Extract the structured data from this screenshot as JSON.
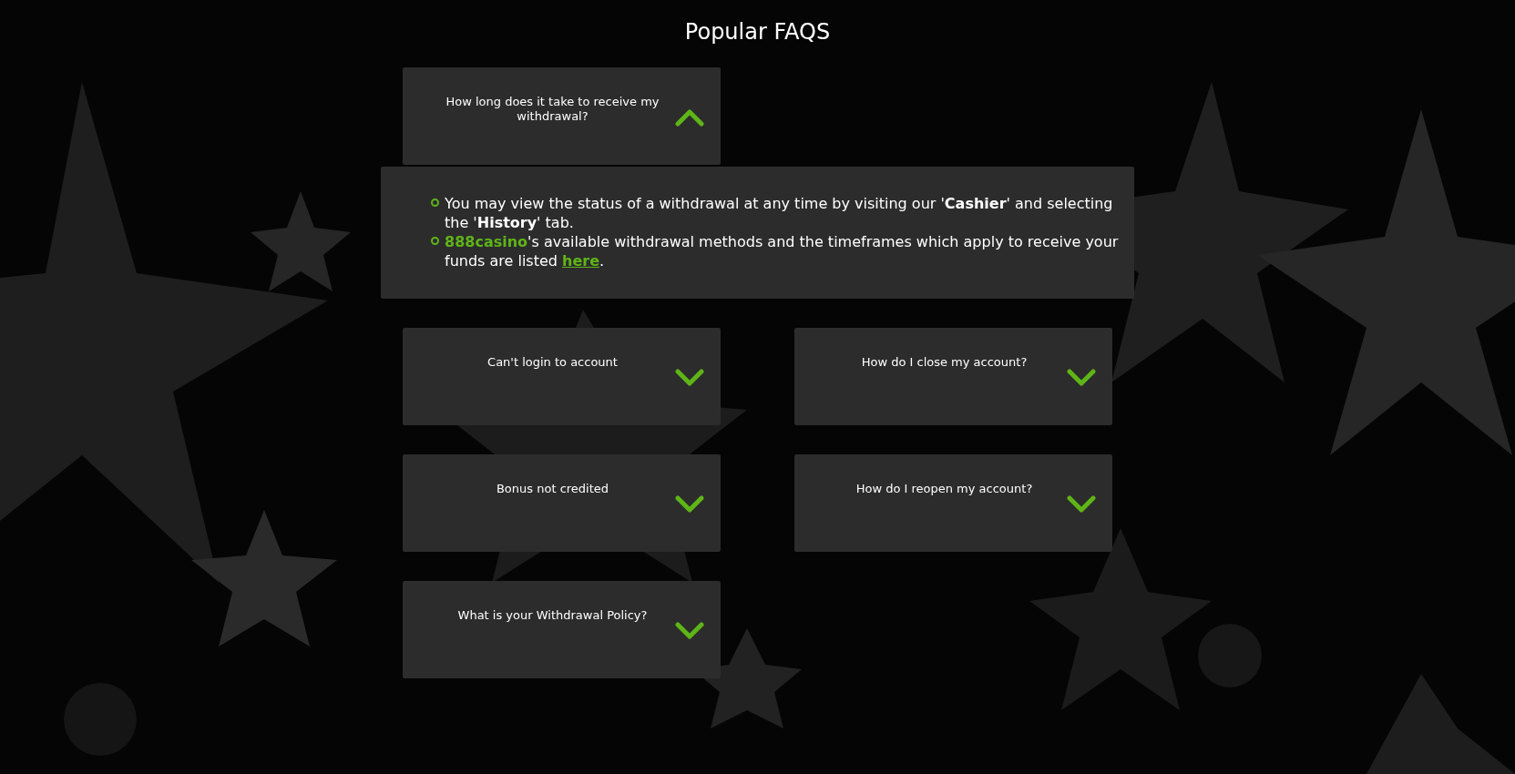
{
  "title": "Popular FAQS",
  "faqs": [
    {
      "question": "How long does it take to receive my withdrawal?",
      "expanded": true,
      "answer": [
        [
          {
            "kind": "plain",
            "text": "You may view the status of a withdrawal at any time by visiting our '"
          },
          {
            "kind": "bold",
            "text": "Cashier"
          },
          {
            "kind": "plain",
            "text": "' and selecting the '"
          },
          {
            "kind": "bold",
            "text": "History"
          },
          {
            "kind": "plain",
            "text": "' tab."
          }
        ],
        [
          {
            "kind": "brand",
            "text": "888casino"
          },
          {
            "kind": "plain",
            "text": "'s available withdrawal methods and the timeframes which apply to receive your funds are listed "
          },
          {
            "kind": "link",
            "text": "here"
          },
          {
            "kind": "plain",
            "text": "."
          }
        ]
      ]
    },
    {
      "question": "Can't login to account",
      "expanded": false
    },
    {
      "question": "How do I close my account?",
      "expanded": false
    },
    {
      "question": "Bonus not credited",
      "expanded": false
    },
    {
      "question": "How do I reopen my account?",
      "expanded": false
    },
    {
      "question": "What is your Withdrawal Policy?",
      "expanded": false
    }
  ]
}
